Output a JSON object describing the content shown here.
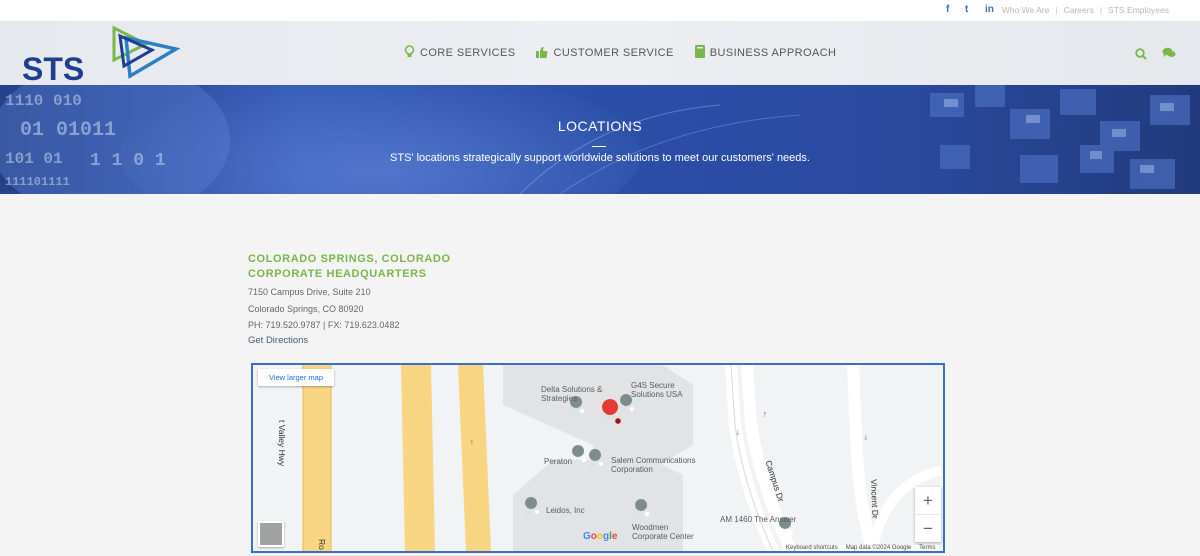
{
  "topbar": {
    "social": [
      "f",
      "t",
      "in"
    ],
    "links": [
      "Who We Are",
      "Careers",
      "STS Employees"
    ],
    "separator": "|"
  },
  "header": {
    "logo_text": "STS",
    "nav": [
      {
        "label": "CORE SERVICES",
        "icon": "lightbulb-icon"
      },
      {
        "label": "CUSTOMER SERVICE",
        "icon": "thumbs-up-icon"
      },
      {
        "label": "BUSINESS APPROACH",
        "icon": "book-icon"
      }
    ],
    "accent": "#7ab648"
  },
  "hero": {
    "title": "LOCATIONS",
    "subtitle": "STS' locations strategically support worldwide solutions to meet our customers' needs."
  },
  "location": {
    "heading_line1": "COLORADO SPRINGS, COLORADO",
    "heading_line2": "CORPORATE HEADQUARTERS",
    "address_line1": "7150 Campus Drive, Suite 210",
    "address_line2": "Colorado Springs, CO 80920",
    "phone": "PH: 719.520.9787 | FX: 719.623.0482",
    "directions": "Get Directions"
  },
  "map": {
    "larger_map": "View larger map",
    "places": [
      "Delta Solutions & Strategies",
      "G4S Secure Solutions USA",
      "Peraton",
      "Salem Communications Corporation",
      "Leidos, Inc",
      "Woodmen Corporate Center",
      "AM 1460 The Answer"
    ],
    "roads": [
      "t Valley Hwy",
      "Campus Dr",
      "Vincent Dr",
      "Ro"
    ],
    "zoom_in": "+",
    "zoom_out": "−",
    "google": "Google",
    "attribution": [
      "Keyboard shortcuts",
      "Map data ©2024 Google",
      "Terms"
    ]
  }
}
